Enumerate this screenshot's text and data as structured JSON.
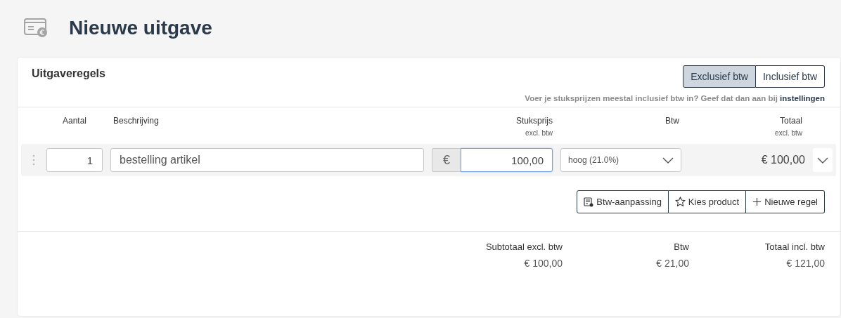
{
  "page": {
    "title": "Nieuwe uitgave"
  },
  "card": {
    "title": "Uitgaveregels",
    "price_mode": [
      {
        "label": "Exclusief btw",
        "selected": true
      },
      {
        "label": "Inclusief btw",
        "selected": false
      }
    ],
    "hint": "Voer je stuksprijzen meestal inclusief btw in? Geef dat dan aan bij",
    "hint_link": "instellingen",
    "columns": [
      {
        "kind": "quantity",
        "label": "Aantal"
      },
      {
        "kind": "description",
        "label": "Beschrijving"
      },
      {
        "kind": "price",
        "label": "Stuksprijs",
        "sublabel": "excl. btw"
      },
      {
        "kind": "vat",
        "label": "Btw"
      },
      {
        "kind": "total",
        "label": "Totaal",
        "sublabel": "excl. btw"
      }
    ],
    "lines": [
      {
        "quantity": "1",
        "description": "bestelling artikel",
        "currency": "€",
        "unit_price": "100,00",
        "price_focused": true,
        "vat": "hoog (21.0%)",
        "total": "€ 100,00"
      }
    ],
    "actions": [
      {
        "kind": "vat-adjust",
        "label": "Btw-aanpassing"
      },
      {
        "kind": "product",
        "label": "Kies product"
      },
      {
        "kind": "add",
        "label": "Nieuwe regel"
      }
    ],
    "summary": [
      {
        "label": "Subtotaal excl. btw",
        "value": "€ 100,00"
      },
      {
        "label": "Btw",
        "value": "€ 21,00"
      },
      {
        "label": "Totaal incl. btw",
        "value": "€ 121,00"
      }
    ]
  }
}
